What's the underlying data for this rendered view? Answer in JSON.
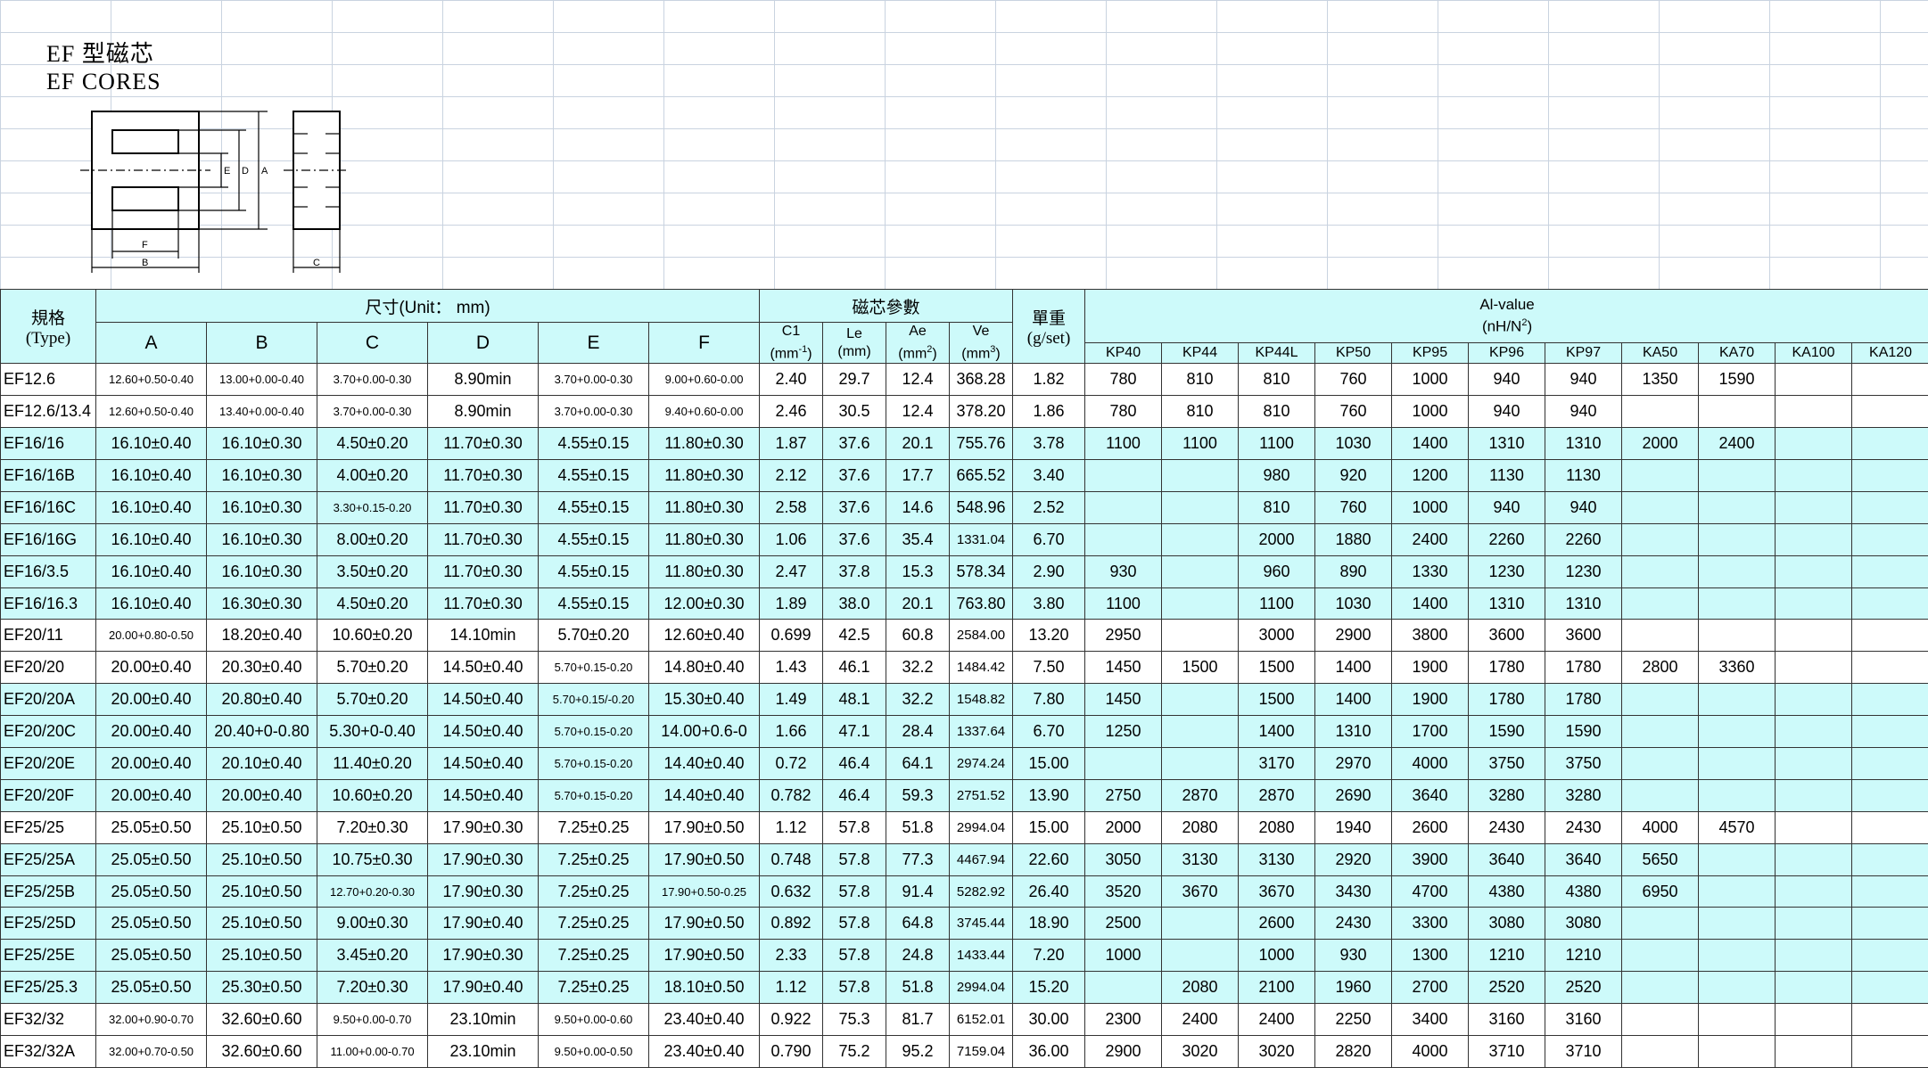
{
  "title_cn": "EF 型磁芯",
  "title_en": "EF CORES",
  "diagram": {
    "labels": {
      "A": "A",
      "B": "B",
      "C": "C",
      "D": "D",
      "E": "E",
      "F": "F"
    }
  },
  "header": {
    "type_cn": "規格",
    "type_en": "(Type)",
    "size_group": "尺寸(Unit： mm)",
    "core_group": "磁芯參數",
    "weight_cn": "單重",
    "weight_en": "(g/set)",
    "al_title": "Al-value",
    "al_unit": "(nH/N",
    "al_unit_sup": "2",
    "al_unit_end": ")",
    "dims": [
      "A",
      "B",
      "C",
      "D",
      "E",
      "F"
    ],
    "params": [
      {
        "name": "C1",
        "unit": "(mm",
        "sup": "-1",
        "end": ")"
      },
      {
        "name": "Le",
        "unit": "(mm)",
        "sup": "",
        "end": ""
      },
      {
        "name": "Ae",
        "unit": "(mm",
        "sup": "2",
        "end": ")"
      },
      {
        "name": "Ve",
        "unit": "(mm",
        "sup": "3",
        "end": ")"
      }
    ],
    "materials": [
      "KP40",
      "KP44",
      "KP44L",
      "KP50",
      "KP95",
      "KP96",
      "KP97",
      "KA50",
      "KA70",
      "KA100",
      "KA120"
    ]
  },
  "rows": [
    {
      "type": "EF12.6",
      "A": "12.60+0.50-0.40",
      "B": "13.00+0.00-0.40",
      "C": "3.70+0.00-0.30",
      "D": "8.90min",
      "E": "3.70+0.00-0.30",
      "F": "9.00+0.60-0.00",
      "C1": "2.40",
      "Le": "29.7",
      "Ae": "12.4",
      "Ve": "368.28",
      "W": "1.82",
      "al": [
        "780",
        "810",
        "810",
        "760",
        "1000",
        "940",
        "940",
        "1350",
        "1590",
        "",
        ""
      ]
    },
    {
      "type": "EF12.6/13.4",
      "A": "12.60+0.50-0.40",
      "B": "13.40+0.00-0.40",
      "C": "3.70+0.00-0.30",
      "D": "8.90min",
      "E": "3.70+0.00-0.30",
      "F": "9.40+0.60-0.00",
      "C1": "2.46",
      "Le": "30.5",
      "Ae": "12.4",
      "Ve": "378.20",
      "W": "1.86",
      "al": [
        "780",
        "810",
        "810",
        "760",
        "1000",
        "940",
        "940",
        "",
        "",
        "",
        ""
      ]
    },
    {
      "type": "EF16/16",
      "A": "16.10±0.40",
      "B": "16.10±0.30",
      "C": "4.50±0.20",
      "D": "11.70±0.30",
      "E": "4.55±0.15",
      "F": "11.80±0.30",
      "C1": "1.87",
      "Le": "37.6",
      "Ae": "20.1",
      "Ve": "755.76",
      "W": "3.78",
      "al": [
        "1100",
        "1100",
        "1100",
        "1030",
        "1400",
        "1310",
        "1310",
        "2000",
        "2400",
        "",
        ""
      ]
    },
    {
      "type": "EF16/16B",
      "A": "16.10±0.40",
      "B": "16.10±0.30",
      "C": "4.00±0.20",
      "D": "11.70±0.30",
      "E": "4.55±0.15",
      "F": "11.80±0.30",
      "C1": "2.12",
      "Le": "37.6",
      "Ae": "17.7",
      "Ve": "665.52",
      "W": "3.40",
      "al": [
        "",
        "",
        "980",
        "920",
        "1200",
        "1130",
        "1130",
        "",
        "",
        "",
        ""
      ]
    },
    {
      "type": "EF16/16C",
      "A": "16.10±0.40",
      "B": "16.10±0.30",
      "C": "3.30+0.15-0.20",
      "D": "11.70±0.30",
      "E": "4.55±0.15",
      "F": "11.80±0.30",
      "C1": "2.58",
      "Le": "37.6",
      "Ae": "14.6",
      "Ve": "548.96",
      "W": "2.52",
      "al": [
        "",
        "",
        "810",
        "760",
        "1000",
        "940",
        "940",
        "",
        "",
        "",
        ""
      ]
    },
    {
      "type": "EF16/16G",
      "A": "16.10±0.40",
      "B": "16.10±0.30",
      "C": "8.00±0.20",
      "D": "11.70±0.30",
      "E": "4.55±0.15",
      "F": "11.80±0.30",
      "C1": "1.06",
      "Le": "37.6",
      "Ae": "35.4",
      "Ve": "1331.04",
      "W": "6.70",
      "al": [
        "",
        "",
        "2000",
        "1880",
        "2400",
        "2260",
        "2260",
        "",
        "",
        "",
        ""
      ]
    },
    {
      "type": "EF16/3.5",
      "A": "16.10±0.40",
      "B": "16.10±0.30",
      "C": "3.50±0.20",
      "D": "11.70±0.30",
      "E": "4.55±0.15",
      "F": "11.80±0.30",
      "C1": "2.47",
      "Le": "37.8",
      "Ae": "15.3",
      "Ve": "578.34",
      "W": "2.90",
      "al": [
        "930",
        "",
        "960",
        "890",
        "1330",
        "1230",
        "1230",
        "",
        "",
        "",
        ""
      ]
    },
    {
      "type": "EF16/16.3",
      "A": "16.10±0.40",
      "B": "16.30±0.30",
      "C": "4.50±0.20",
      "D": "11.70±0.30",
      "E": "4.55±0.15",
      "F": "12.00±0.30",
      "C1": "1.89",
      "Le": "38.0",
      "Ae": "20.1",
      "Ve": "763.80",
      "W": "3.80",
      "al": [
        "1100",
        "",
        "1100",
        "1030",
        "1400",
        "1310",
        "1310",
        "",
        "",
        "",
        ""
      ]
    },
    {
      "type": "EF20/11",
      "A": "20.00+0.80-0.50",
      "B": "18.20±0.40",
      "C": "10.60±0.20",
      "D": "14.10min",
      "E": "5.70±0.20",
      "F": "12.60±0.40",
      "C1": "0.699",
      "Le": "42.5",
      "Ae": "60.8",
      "Ve": "2584.00",
      "W": "13.20",
      "al": [
        "2950",
        "",
        "3000",
        "2900",
        "3800",
        "3600",
        "3600",
        "",
        "",
        "",
        ""
      ]
    },
    {
      "type": "EF20/20",
      "A": "20.00±0.40",
      "B": "20.30±0.40",
      "C": "5.70±0.20",
      "D": "14.50±0.40",
      "E": "5.70+0.15-0.20",
      "F": "14.80±0.40",
      "C1": "1.43",
      "Le": "46.1",
      "Ae": "32.2",
      "Ve": "1484.42",
      "W": "7.50",
      "al": [
        "1450",
        "1500",
        "1500",
        "1400",
        "1900",
        "1780",
        "1780",
        "2800",
        "3360",
        "",
        ""
      ]
    },
    {
      "type": "EF20/20A",
      "A": "20.00±0.40",
      "B": "20.80±0.40",
      "C": "5.70±0.20",
      "D": "14.50±0.40",
      "E": "5.70+0.15/-0.20",
      "F": "15.30±0.40",
      "C1": "1.49",
      "Le": "48.1",
      "Ae": "32.2",
      "Ve": "1548.82",
      "W": "7.80",
      "al": [
        "1450",
        "",
        "1500",
        "1400",
        "1900",
        "1780",
        "1780",
        "",
        "",
        "",
        ""
      ]
    },
    {
      "type": "EF20/20C",
      "A": "20.00±0.40",
      "B": "20.40+0-0.80",
      "C": "5.30+0-0.40",
      "D": "14.50±0.40",
      "E": "5.70+0.15-0.20",
      "F": "14.00+0.6-0",
      "C1": "1.66",
      "Le": "47.1",
      "Ae": "28.4",
      "Ve": "1337.64",
      "W": "6.70",
      "al": [
        "1250",
        "",
        "1400",
        "1310",
        "1700",
        "1590",
        "1590",
        "",
        "",
        "",
        ""
      ]
    },
    {
      "type": "EF20/20E",
      "A": "20.00±0.40",
      "B": "20.10±0.40",
      "C": "11.40±0.20",
      "D": "14.50±0.40",
      "E": "5.70+0.15-0.20",
      "F": "14.40±0.40",
      "C1": "0.72",
      "Le": "46.4",
      "Ae": "64.1",
      "Ve": "2974.24",
      "W": "15.00",
      "al": [
        "",
        "",
        "3170",
        "2970",
        "4000",
        "3750",
        "3750",
        "",
        "",
        "",
        ""
      ]
    },
    {
      "type": "EF20/20F",
      "A": "20.00±0.40",
      "B": "20.00±0.40",
      "C": "10.60±0.20",
      "D": "14.50±0.40",
      "E": "5.70+0.15-0.20",
      "F": "14.40±0.40",
      "C1": "0.782",
      "Le": "46.4",
      "Ae": "59.3",
      "Ve": "2751.52",
      "W": "13.90",
      "al": [
        "2750",
        "2870",
        "2870",
        "2690",
        "3640",
        "3280",
        "3280",
        "",
        "",
        "",
        ""
      ]
    },
    {
      "type": "EF25/25",
      "A": "25.05±0.50",
      "B": "25.10±0.50",
      "C": "7.20±0.30",
      "D": "17.90±0.30",
      "E": "7.25±0.25",
      "F": "17.90±0.50",
      "C1": "1.12",
      "Le": "57.8",
      "Ae": "51.8",
      "Ve": "2994.04",
      "W": "15.00",
      "al": [
        "2000",
        "2080",
        "2080",
        "1940",
        "2600",
        "2430",
        "2430",
        "4000",
        "4570",
        "",
        ""
      ]
    },
    {
      "type": "EF25/25A",
      "A": "25.05±0.50",
      "B": "25.10±0.50",
      "C": "10.75±0.30",
      "D": "17.90±0.30",
      "E": "7.25±0.25",
      "F": "17.90±0.50",
      "C1": "0.748",
      "Le": "57.8",
      "Ae": "77.3",
      "Ve": "4467.94",
      "W": "22.60",
      "al": [
        "3050",
        "3130",
        "3130",
        "2920",
        "3900",
        "3640",
        "3640",
        "5650",
        "",
        "",
        ""
      ]
    },
    {
      "type": "EF25/25B",
      "A": "25.05±0.50",
      "B": "25.10±0.50",
      "C": "12.70+0.20-0.30",
      "D": "17.90±0.30",
      "E": "7.25±0.25",
      "F": "17.90+0.50-0.25",
      "C1": "0.632",
      "Le": "57.8",
      "Ae": "91.4",
      "Ve": "5282.92",
      "W": "26.40",
      "al": [
        "3520",
        "3670",
        "3670",
        "3430",
        "4700",
        "4380",
        "4380",
        "6950",
        "",
        "",
        ""
      ]
    },
    {
      "type": "EF25/25D",
      "A": "25.05±0.50",
      "B": "25.10±0.50",
      "C": "9.00±0.30",
      "D": "17.90±0.40",
      "E": "7.25±0.25",
      "F": "17.90±0.50",
      "C1": "0.892",
      "Le": "57.8",
      "Ae": "64.8",
      "Ve": "3745.44",
      "W": "18.90",
      "al": [
        "2500",
        "",
        "2600",
        "2430",
        "3300",
        "3080",
        "3080",
        "",
        "",
        "",
        ""
      ]
    },
    {
      "type": "EF25/25E",
      "A": "25.05±0.50",
      "B": "25.10±0.50",
      "C": "3.45±0.20",
      "D": "17.90±0.30",
      "E": "7.25±0.25",
      "F": "17.90±0.50",
      "C1": "2.33",
      "Le": "57.8",
      "Ae": "24.8",
      "Ve": "1433.44",
      "W": "7.20",
      "al": [
        "1000",
        "",
        "1000",
        "930",
        "1300",
        "1210",
        "1210",
        "",
        "",
        "",
        ""
      ]
    },
    {
      "type": "EF25/25.3",
      "A": "25.05±0.50",
      "B": "25.30±0.50",
      "C": "7.20±0.30",
      "D": "17.90±0.40",
      "E": "7.25±0.25",
      "F": "18.10±0.50",
      "C1": "1.12",
      "Le": "57.8",
      "Ae": "51.8",
      "Ve": "2994.04",
      "W": "15.20",
      "al": [
        "",
        "2080",
        "2100",
        "1960",
        "2700",
        "2520",
        "2520",
        "",
        "",
        "",
        ""
      ]
    },
    {
      "type": "EF32/32",
      "A": "32.00+0.90-0.70",
      "B": "32.60±0.60",
      "C": "9.50+0.00-0.70",
      "D": "23.10min",
      "E": "9.50+0.00-0.60",
      "F": "23.40±0.40",
      "C1": "0.922",
      "Le": "75.3",
      "Ae": "81.7",
      "Ve": "6152.01",
      "W": "30.00",
      "al": [
        "2300",
        "2400",
        "2400",
        "2250",
        "3400",
        "3160",
        "3160",
        "",
        "",
        "",
        ""
      ]
    },
    {
      "type": "EF32/32A",
      "A": "32.00+0.70-0.50",
      "B": "32.60±0.60",
      "C": "11.00+0.00-0.70",
      "D": "23.10min",
      "E": "9.50+0.00-0.50",
      "F": "23.40±0.40",
      "C1": "0.790",
      "Le": "75.2",
      "Ae": "95.2",
      "Ve": "7159.04",
      "W": "36.00",
      "al": [
        "2900",
        "3020",
        "3020",
        "2820",
        "4000",
        "3710",
        "3710",
        "",
        "",
        "",
        ""
      ]
    }
  ]
}
